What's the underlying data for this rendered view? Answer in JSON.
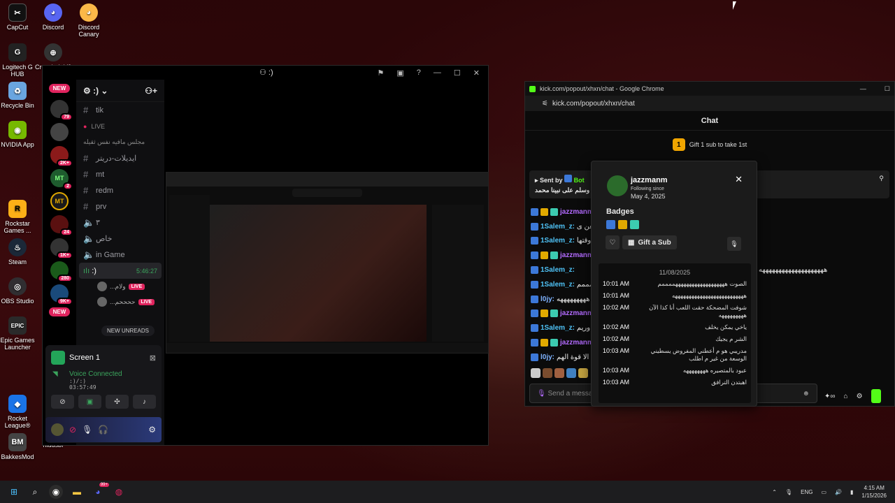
{
  "desktop": {
    "icons": [
      {
        "label": "CapCut",
        "icon": "capcut-icon",
        "color": "#111111"
      },
      {
        "label": "Discord",
        "icon": "discord-icon",
        "color": "#5865f2"
      },
      {
        "label": "Discord Canary",
        "icon": "discord-canary-icon",
        "color": "#fbb848"
      },
      {
        "label": "Logitech G HUB",
        "icon": "logitech-icon",
        "color": "#222222"
      },
      {
        "label": "Crosshair V2",
        "icon": "crosshair-icon",
        "color": "#333333"
      },
      {
        "label": "Recycle Bin",
        "icon": "recycle-bin-icon",
        "color": "#6aa5e0"
      },
      {
        "label": "NVIDIA App",
        "icon": "nvidia-icon",
        "color": "#76b900"
      },
      {
        "label": "Rockstar Games ...",
        "icon": "rockstar-icon",
        "color": "#fcaf17"
      },
      {
        "label": "Steam",
        "icon": "steam-icon",
        "color": "#1b2838"
      },
      {
        "label": "OBS Studio",
        "icon": "obs-icon",
        "color": "#302e31"
      },
      {
        "label": "Epic Games Launcher",
        "icon": "epic-games-icon",
        "color": "#2a2a2a"
      },
      {
        "label": "Rocket League®",
        "icon": "rocket-league-icon",
        "color": "#1a73e8"
      },
      {
        "label": "BakkesMod",
        "icon": "bakkesmod-icon",
        "color": "#444444"
      },
      {
        "label": "hidusbf",
        "icon": "folder-icon",
        "color": "#000000"
      }
    ]
  },
  "discord": {
    "window_title": ":)",
    "server_name": ":)",
    "new_badge": "NEW",
    "server_badges": [
      "79",
      "2K+",
      "2",
      "24",
      "1K+",
      "280",
      "9K+"
    ],
    "mt_label": "MT",
    "channels": [
      {
        "label": "tik",
        "type": "text"
      },
      {
        "label": "LIVE",
        "type": "category"
      },
      {
        "label": "مجلس مافيه نفس ثقيله",
        "type": "category"
      },
      {
        "label": "ايديلات-دريتر",
        "type": "text"
      },
      {
        "label": "mt",
        "type": "text"
      },
      {
        "label": "redm",
        "type": "text"
      },
      {
        "label": "prv",
        "type": "text"
      },
      {
        "label": "٣",
        "type": "voice"
      },
      {
        "label": "خاص",
        "type": "voice"
      },
      {
        "label": "in Game",
        "type": "voice"
      }
    ],
    "active_voice": {
      "label": ":)",
      "timer": "5:46:27"
    },
    "voice_users": [
      {
        "name": "...ولام",
        "live": "LIVE"
      },
      {
        "name": "...ححححم",
        "live": "LIVE"
      }
    ],
    "new_unreads": "NEW UNREADS",
    "screen_label": "Screen 1",
    "voice_status": "Voice Connected",
    "voice_channel": ":)/:)",
    "voice_time": "03:57:49"
  },
  "chrome": {
    "title": "kick.com/popout/xhxn/chat - Google Chrome",
    "url": "kick.com/popout/xhxn/chat",
    "chat_header": "Chat",
    "gift_rank": "1",
    "gift_text": "Gift 1 sub to take 1st",
    "pinned_sent_by": "Sent by",
    "pinned_user": "Bot",
    "pinned_text": "ل وسلم على نبينا محمد",
    "chat_lines": [
      {
        "user": "jazzmanm",
        "color": "#b36bff",
        "text": ""
      },
      {
        "user": "1Salem_z:",
        "color": "#4fc3f7",
        "text": "عععععن ى"
      },
      {
        "user": "1Salem_z:",
        "color": "#4fc3f7",
        "text": "وقتها"
      },
      {
        "user": "jazzmanm",
        "color": "#b36bff",
        "text": ""
      },
      {
        "user": "1Salem_z:",
        "color": "#4fc3f7",
        "text": "ههههههههههههههههههههه ن"
      },
      {
        "user": "1Salem_z:",
        "color": "#4fc3f7",
        "text": "حمممم"
      },
      {
        "user": "l0jy:",
        "color": "#7fb3ff",
        "text": "هههههههههه"
      },
      {
        "user": "jazzmanm",
        "color": "#b36bff",
        "text": ""
      },
      {
        "user": "1Salem_z:",
        "color": "#4fc3f7",
        "text": "يه وريم"
      },
      {
        "user": "jazzmanm",
        "color": "#b36bff",
        "text": ""
      },
      {
        "user": "l0jy:",
        "color": "#7fb3ff",
        "text": "عدها الا قوة الهم"
      }
    ],
    "input_placeholder": "Send a message"
  },
  "user_card": {
    "username": "jazzmanm",
    "following_since_label": "Following since",
    "following_since_date": "May 4, 2025",
    "badges_title": "Badges",
    "gift_button": "Gift a Sub",
    "history_date": "11/08/2025",
    "messages": [
      {
        "time": "10:01 AM",
        "text": "الصوت هههههههههههههههههههممممم"
      },
      {
        "time": "10:01 AM",
        "text": "ههههههههههههههههههههههههههه"
      },
      {
        "time": "10:02 AM",
        "text": "شوفت المضحكة حقت اللعب أنا كذا الآن هههههههههه"
      },
      {
        "time": "10:02 AM",
        "text": "ياخي يمكن يخلف"
      },
      {
        "time": "10:02 AM",
        "text": "الشر م يجيك"
      },
      {
        "time": "10:03 AM",
        "text": "مدريبي هو م أعطني المفروض يسطيني الوسعة من غير م اطلب"
      },
      {
        "time": "10:03 AM",
        "text": "عبود بالمتصيره ههههههههه"
      },
      {
        "time": "10:03 AM",
        "text": "اهبتدن الترافق"
      }
    ]
  },
  "taskbar": {
    "lang": "ENG",
    "time": "4:15 AM",
    "date": "1/15/2026",
    "discord_badge": "99+"
  }
}
